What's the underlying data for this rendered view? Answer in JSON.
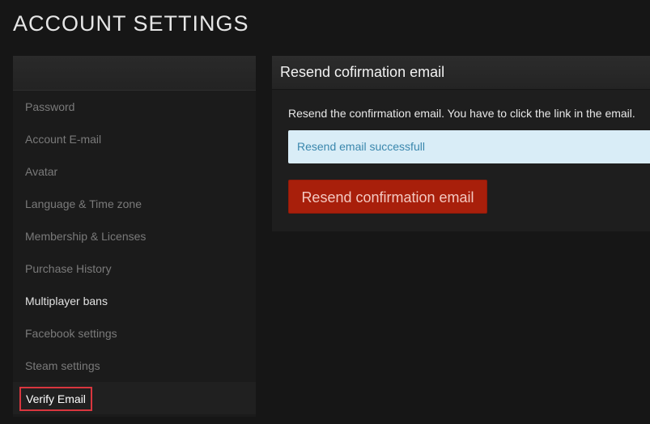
{
  "page": {
    "title": "ACCOUNT SETTINGS"
  },
  "sidebar": {
    "items": [
      {
        "label": "Password",
        "state": "normal"
      },
      {
        "label": "Account E-mail",
        "state": "normal"
      },
      {
        "label": "Avatar",
        "state": "normal"
      },
      {
        "label": "Language & Time zone",
        "state": "normal"
      },
      {
        "label": "Membership & Licenses",
        "state": "normal"
      },
      {
        "label": "Purchase History",
        "state": "normal"
      },
      {
        "label": "Multiplayer bans",
        "state": "bright"
      },
      {
        "label": "Facebook settings",
        "state": "normal"
      },
      {
        "label": "Steam settings",
        "state": "normal"
      },
      {
        "label": "Verify Email",
        "state": "active"
      }
    ]
  },
  "panel": {
    "title": "Resend cofirmation email",
    "description": "Resend the confirmation email. You have to click the link in the email.",
    "alert": "Resend email successfull",
    "button_label": "Resend confirmation email"
  },
  "colors": {
    "background": "#161616",
    "button": "#a81f0b",
    "alert_bg": "#d9edf7",
    "alert_text": "#3a87ad",
    "highlight_border": "#d9363e"
  }
}
